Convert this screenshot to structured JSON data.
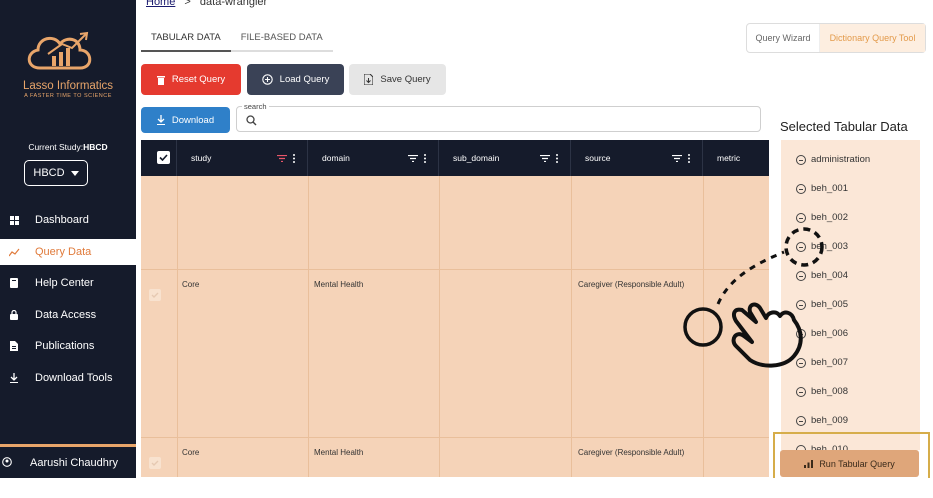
{
  "app": {
    "brand": "Lasso Informatics",
    "tagline": "A FASTER TIME TO SCIENCE"
  },
  "sidebar": {
    "study_label": "Current Study:",
    "study_value": "HBCD",
    "study_button": "HBCD",
    "items": [
      {
        "label": "Dashboard",
        "icon": "dashboard-icon"
      },
      {
        "label": "Query Data",
        "icon": "query-icon"
      },
      {
        "label": "Help Center",
        "icon": "book-icon"
      },
      {
        "label": "Data Access",
        "icon": "lock-icon"
      },
      {
        "label": "Publications",
        "icon": "document-icon"
      },
      {
        "label": "Download Tools",
        "icon": "download-icon"
      }
    ],
    "user": "Aarushi Chaudhry"
  },
  "breadcrumb": {
    "home": "Home",
    "separator": ">",
    "current": "data-wrangler"
  },
  "tabs": [
    "TABULAR DATA",
    "FILE-BASED DATA"
  ],
  "modes": {
    "query_wizard": "Query Wizard",
    "dictionary": "Dictionary Query Tool"
  },
  "actions": {
    "reset": "Reset Query",
    "load": "Load Query",
    "save": "Save Query",
    "download": "Download"
  },
  "search": {
    "label": "search",
    "placeholder": ""
  },
  "table": {
    "columns": [
      "study",
      "domain",
      "sub_domain",
      "source",
      "metric"
    ],
    "rows": [
      {
        "study": "",
        "domain": "",
        "sub_domain": "",
        "source": "",
        "metric": ""
      },
      {
        "study": "Core",
        "domain": "Mental Health",
        "sub_domain": "",
        "source": "Caregiver (Responsible Adult)",
        "metric": ""
      },
      {
        "study": "Core",
        "domain": "Mental Health",
        "sub_domain": "",
        "source": "Caregiver (Responsible Adult)",
        "metric": ""
      }
    ]
  },
  "selected_panel": {
    "title": "Selected Tabular Data",
    "items": [
      "administration",
      "beh_001",
      "beh_002",
      "beh_003",
      "beh_004",
      "beh_005",
      "beh_006",
      "beh_007",
      "beh_008",
      "beh_009",
      "beh_010"
    ],
    "run_button": "Run Tabular Query"
  },
  "colors": {
    "sidebar_bg": "#151b2b",
    "accent": "#e07a3a",
    "row_selected": "#f5d3b8",
    "reset": "#e53a2f",
    "download": "#2f80c9"
  }
}
